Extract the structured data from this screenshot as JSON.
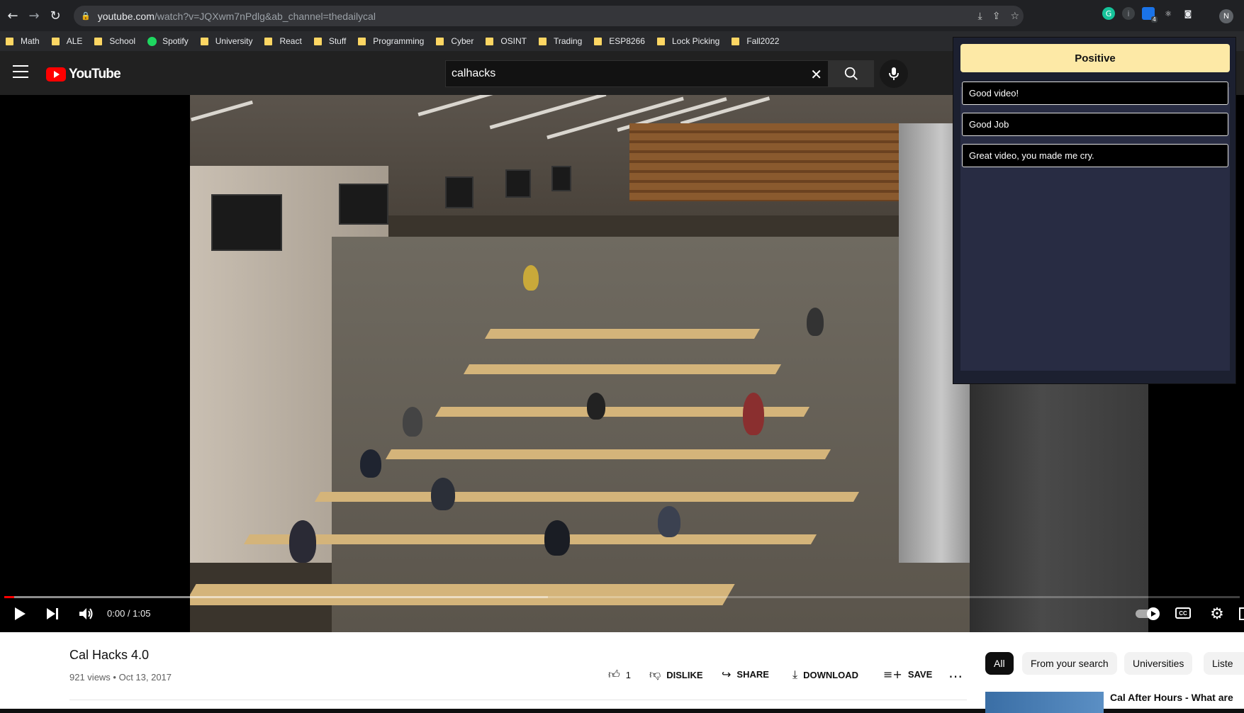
{
  "browser": {
    "url_main": "youtube.com",
    "url_rest": "/watch?v=JQXwm7nPdlg&ab_channel=thedailycal",
    "profile_initial": "N",
    "extension_badge": "4",
    "bookmarks": [
      {
        "label": "Math",
        "type": "folder"
      },
      {
        "label": "ALE",
        "type": "folder"
      },
      {
        "label": "School",
        "type": "folder"
      },
      {
        "label": "Spotify",
        "type": "spotify"
      },
      {
        "label": "University",
        "type": "folder"
      },
      {
        "label": "React",
        "type": "folder"
      },
      {
        "label": "Stuff",
        "type": "folder"
      },
      {
        "label": "Programming",
        "type": "folder"
      },
      {
        "label": "Cyber",
        "type": "folder"
      },
      {
        "label": "OSINT",
        "type": "folder"
      },
      {
        "label": "Trading",
        "type": "folder"
      },
      {
        "label": "ESP8266",
        "type": "folder"
      },
      {
        "label": "Lock Picking",
        "type": "folder"
      },
      {
        "label": "Fall2022",
        "type": "folder"
      }
    ]
  },
  "youtube": {
    "logo_text": "YouTube",
    "search_value": "calhacks"
  },
  "player": {
    "time": "0:00 / 1:05",
    "progress_fraction": 0.0,
    "buffered_fraction": 0.44
  },
  "extension": {
    "sentiment_label": "Positive",
    "comments": [
      "Good video!",
      "Good Job",
      "Great video, you made me cry."
    ]
  },
  "video": {
    "title": "Cal Hacks 4.0",
    "meta": "921 views • Oct 13, 2017",
    "likes": "1",
    "dislike_label": "DISLIKE",
    "share_label": "SHARE",
    "download_label": "DOWNLOAD",
    "save_label": "SAVE"
  },
  "chips": [
    "All",
    "From your search",
    "Universities",
    "Liste"
  ],
  "recommendation": {
    "title": "Cal After Hours - What are"
  },
  "colors": {
    "yt_red": "#ff0000",
    "sentiment_bg": "#fde9a6",
    "popup_bg": "#282c43"
  }
}
